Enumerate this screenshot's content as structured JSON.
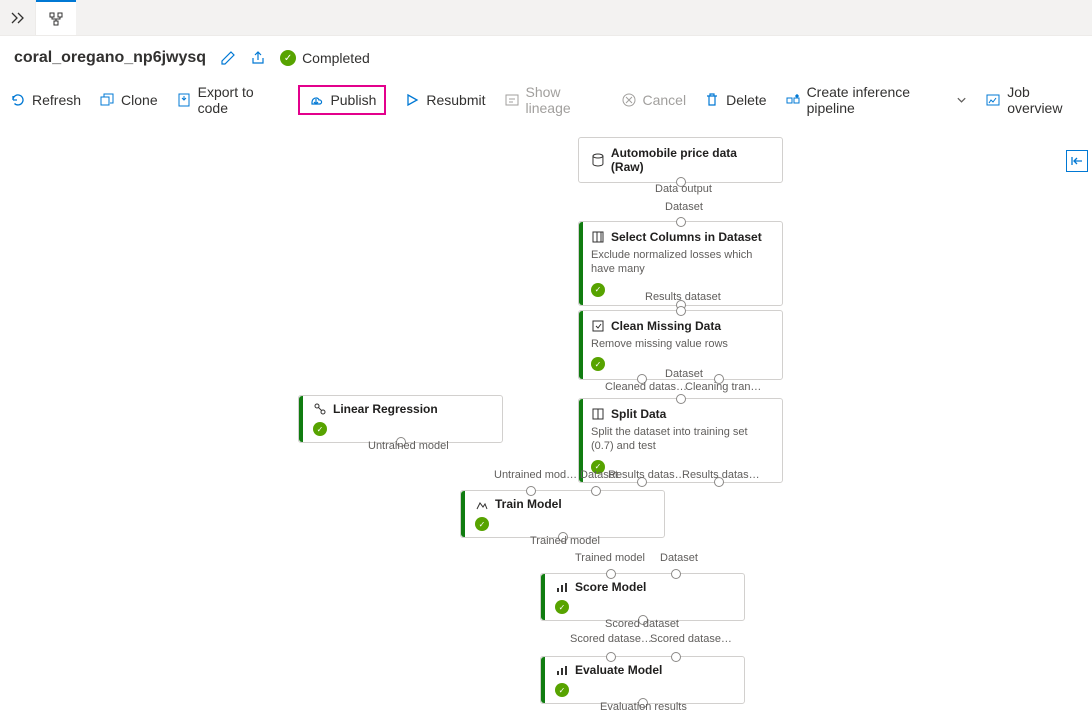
{
  "title": "coral_oregano_np6jwysq",
  "status": {
    "label": "Completed"
  },
  "toolbar": {
    "refresh": "Refresh",
    "clone": "Clone",
    "export": "Export to code",
    "publish": "Publish",
    "resubmit": "Resubmit",
    "lineage": "Show lineage",
    "cancel": "Cancel",
    "delete": "Delete",
    "inference": "Create inference pipeline",
    "joboverview": "Job overview"
  },
  "nodes": {
    "auto": {
      "title": "Automobile price data (Raw)"
    },
    "select": {
      "title": "Select Columns in Dataset",
      "desc": "Exclude normalized losses which have many"
    },
    "clean": {
      "title": "Clean Missing Data",
      "desc": "Remove missing value rows"
    },
    "split": {
      "title": "Split Data",
      "desc": "Split the dataset into training set (0.7) and test"
    },
    "linreg": {
      "title": "Linear Regression"
    },
    "train": {
      "title": "Train Model"
    },
    "score": {
      "title": "Score Model"
    },
    "eval": {
      "title": "Evaluate Model"
    }
  },
  "ports": {
    "data_output": "Data output",
    "dataset": "Dataset",
    "results_dataset": "Results dataset",
    "dataset2": "Dataset",
    "cleaned_data": "Cleaned datas…",
    "cleaning_tran": "Cleaning tran…",
    "results_data1": "Results datas…",
    "results_data2": "Results datas…",
    "untrained_model": "Untrained model",
    "untrained_mod": "Untrained mod…",
    "trained_model": "Trained model",
    "trained_model2": "Trained model",
    "dataset3": "Dataset",
    "dataset4": "Dataset",
    "scored_dataset": "Scored dataset",
    "scored_datase1": "Scored datase…",
    "scored_datase2": "Scored datase…",
    "eval_results": "Evaluation results"
  }
}
